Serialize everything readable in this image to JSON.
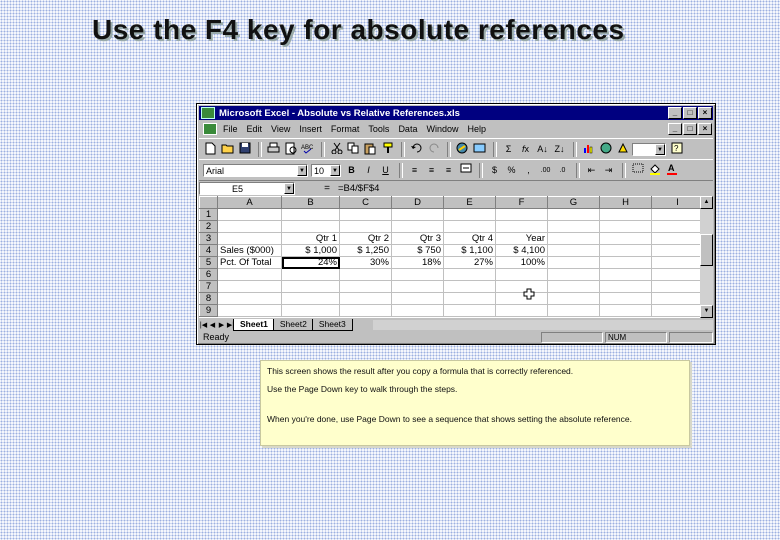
{
  "slide": {
    "title": "Use the F4 key for absolute references"
  },
  "window": {
    "title": "Microsoft Excel - Absolute vs Relative References.xls",
    "caption_buttons": [
      "_",
      "□",
      "×"
    ],
    "doc_buttons": [
      "_",
      "□",
      "×"
    ]
  },
  "menu": [
    "File",
    "Edit",
    "View",
    "Insert",
    "Format",
    "Tools",
    "Data",
    "Window",
    "Help"
  ],
  "toolbar_standard": [
    "new-icon",
    "open-icon",
    "save-icon",
    "print-icon",
    "print-preview-icon",
    "spelling-icon",
    "cut-icon",
    "copy-icon",
    "paste-icon",
    "format-painter-icon",
    "undo-icon",
    "redo-icon",
    "hyperlink-icon",
    "web-toolbar-icon",
    "autosum-icon",
    "function-icon",
    "sort-ascending-icon",
    "sort-descending-icon",
    "chart-wizard-icon",
    "map-icon",
    "drawing-icon",
    "zoom-icon",
    "help-icon"
  ],
  "formatting": {
    "font": "Arial",
    "size": "10",
    "bold": "B",
    "italic": "I",
    "underline": "U",
    "currency": "$",
    "percent": "%",
    "comma": ",",
    "inc_decimal": ".00",
    "dec_decimal": ".0"
  },
  "formula_bar": {
    "name_box": "E5",
    "equals": "=",
    "formula": "=B4/$F$4"
  },
  "grid": {
    "columns": [
      "",
      "A",
      "B",
      "C",
      "D",
      "E",
      "F",
      "G",
      "H",
      "I"
    ],
    "rows": [
      [
        "1",
        "",
        "",
        "",
        "",
        "",
        "",
        "",
        "",
        ""
      ],
      [
        "2",
        "",
        "",
        "",
        "",
        "",
        "",
        "",
        "",
        ""
      ],
      [
        "3",
        "",
        "Qtr 1",
        "Qtr 2",
        "Qtr 3",
        "Qtr 4",
        "Year",
        "",
        "",
        ""
      ],
      [
        "4",
        "Sales ($000)",
        "$  1,000",
        "$  1,250",
        "$     750",
        "$  1,100",
        "$  4,100",
        "",
        "",
        ""
      ],
      [
        "5",
        "Pct. Of Total",
        "24%",
        "30%",
        "18%",
        "27%",
        "100%",
        "",
        "",
        ""
      ],
      [
        "6",
        "",
        "",
        "",
        "",
        "",
        "",
        "",
        "",
        ""
      ],
      [
        "7",
        "",
        "",
        "",
        "",
        "",
        "",
        "",
        "",
        ""
      ],
      [
        "8",
        "",
        "",
        "",
        "",
        "",
        "",
        "",
        "",
        ""
      ],
      [
        "9",
        "",
        "",
        "",
        "",
        "",
        "",
        "",
        "",
        ""
      ]
    ]
  },
  "sheets": [
    "Sheet1",
    "Sheet2",
    "Sheet3"
  ],
  "status": {
    "ready": "Ready",
    "num": "NUM"
  },
  "note": {
    "line1": "This screen shows the result after you copy a formula that is correctly referenced.",
    "line2": "Use the Page Down key to walk through the steps.",
    "line3": "When you're done, use Page Down to see a sequence that shows setting the absolute reference."
  }
}
